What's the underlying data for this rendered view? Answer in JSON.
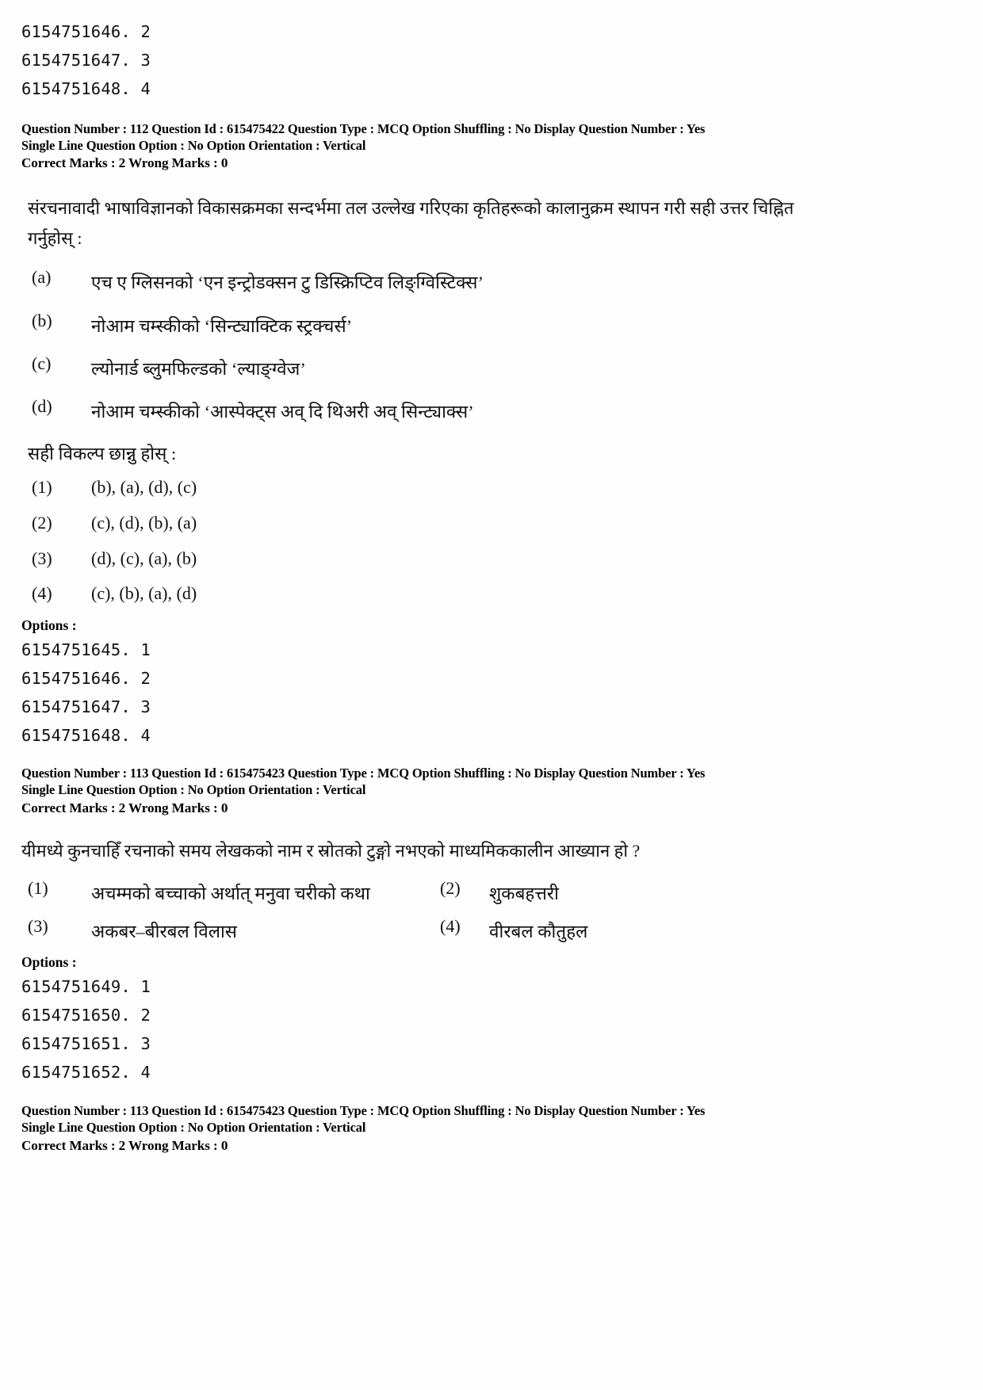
{
  "page": {
    "top_option_ids": [
      "6154751646. 2",
      "6154751647. 3",
      "6154751648. 4"
    ]
  },
  "questions": [
    {
      "meta": {
        "line1": "Question Number : 112  Question Id : 615475422  Question Type : MCQ  Option Shuffling : No  Display Question Number : Yes",
        "line2": "Single Line Question Option : No  Option Orientation : Vertical",
        "line3": "Correct Marks : 2  Wrong Marks : 0",
        "question_number": "112",
        "question_id": "615475422",
        "question_type": "MCQ",
        "option_shuffling": "No",
        "display_question_number": "Yes",
        "single_line_question_option": "No",
        "option_orientation": "Vertical",
        "correct_marks": "2",
        "wrong_marks": "0"
      },
      "stem_line1": "संरचनावादी भाषाविज्ञानको विकासक्रमका सन्दर्भमा तल उल्लेख गरिएका कृतिहरूको कालानुक्रम स्थापन गरी सही उत्तर चिह्नित",
      "stem_line2": "गर्नुहोस् :",
      "items": [
        {
          "label": "(a)",
          "text": "एच ए ग्लिसनको ‘एन इन्ट्रोडक्सन टु डिस्क्रिप्टिव लिङ्ग्विस्टिक्स’"
        },
        {
          "label": "(b)",
          "text": "नोआम चम्स्कीको ‘सिन्ट्याक्टिक स्ट्रक्चर्स’"
        },
        {
          "label": "(c)",
          "text": "ल्योनार्ड ब्लुमफिल्डको ‘ल्याङ्ग्वेज’"
        },
        {
          "label": "(d)",
          "text": "नोआम चम्स्कीको ‘आस्पेक्ट्स अव् दि थिअरी अव् सिन्ट्याक्स’"
        }
      ],
      "choose_prompt": "सही विकल्प छान्नु होस् :",
      "choices": [
        {
          "num": "(1)",
          "text": "(b), (a), (d), (c)"
        },
        {
          "num": "(2)",
          "text": "(c), (d), (b), (a)"
        },
        {
          "num": "(3)",
          "text": "(d), (c), (a), (b)"
        },
        {
          "num": "(4)",
          "text": "(c), (b), (a), (d)"
        }
      ],
      "options_label": "Options :",
      "option_ids": [
        "6154751645. 1",
        "6154751646. 2",
        "6154751647. 3",
        "6154751648. 4"
      ]
    },
    {
      "meta": {
        "line1": "Question Number : 113  Question Id : 615475423  Question Type : MCQ  Option Shuffling : No  Display Question Number : Yes",
        "line2": "Single Line Question Option : No  Option Orientation : Vertical",
        "line3": "Correct Marks : 2  Wrong Marks : 0",
        "question_number": "113",
        "question_id": "615475423",
        "question_type": "MCQ",
        "option_shuffling": "No",
        "display_question_number": "Yes",
        "single_line_question_option": "No",
        "option_orientation": "Vertical",
        "correct_marks": "2",
        "wrong_marks": "0"
      },
      "stem_line1": "यीमध्ये कुनचाहिँ रचनाको समय लेखकको नाम र स्रोतको टुङ्गो नभएको माध्यमिककालीन आख्यान हो ?",
      "choices": [
        {
          "num": "(1)",
          "text": "अचम्मको बच्चाको अर्थात् मनुवा चरीको कथा"
        },
        {
          "num": "(2)",
          "text": "शुकबहत्तरी"
        },
        {
          "num": "(3)",
          "text": "अकबर–बीरबल विलास"
        },
        {
          "num": "(4)",
          "text": "वीरबल कौतुहल"
        }
      ],
      "options_label": "Options :",
      "option_ids": [
        "6154751649. 1",
        "6154751650. 2",
        "6154751651. 3",
        "6154751652. 4"
      ]
    },
    {
      "meta": {
        "line1": "Question Number : 113  Question Id : 615475423  Question Type : MCQ  Option Shuffling : No  Display Question Number : Yes",
        "line2": "Single Line Question Option : No  Option Orientation : Vertical",
        "line3": "Correct Marks : 2  Wrong Marks : 0",
        "question_number": "113",
        "question_id": "615475423",
        "question_type": "MCQ",
        "option_shuffling": "No",
        "display_question_number": "Yes",
        "single_line_question_option": "No",
        "option_orientation": "Vertical",
        "correct_marks": "2",
        "wrong_marks": "0"
      }
    }
  ]
}
